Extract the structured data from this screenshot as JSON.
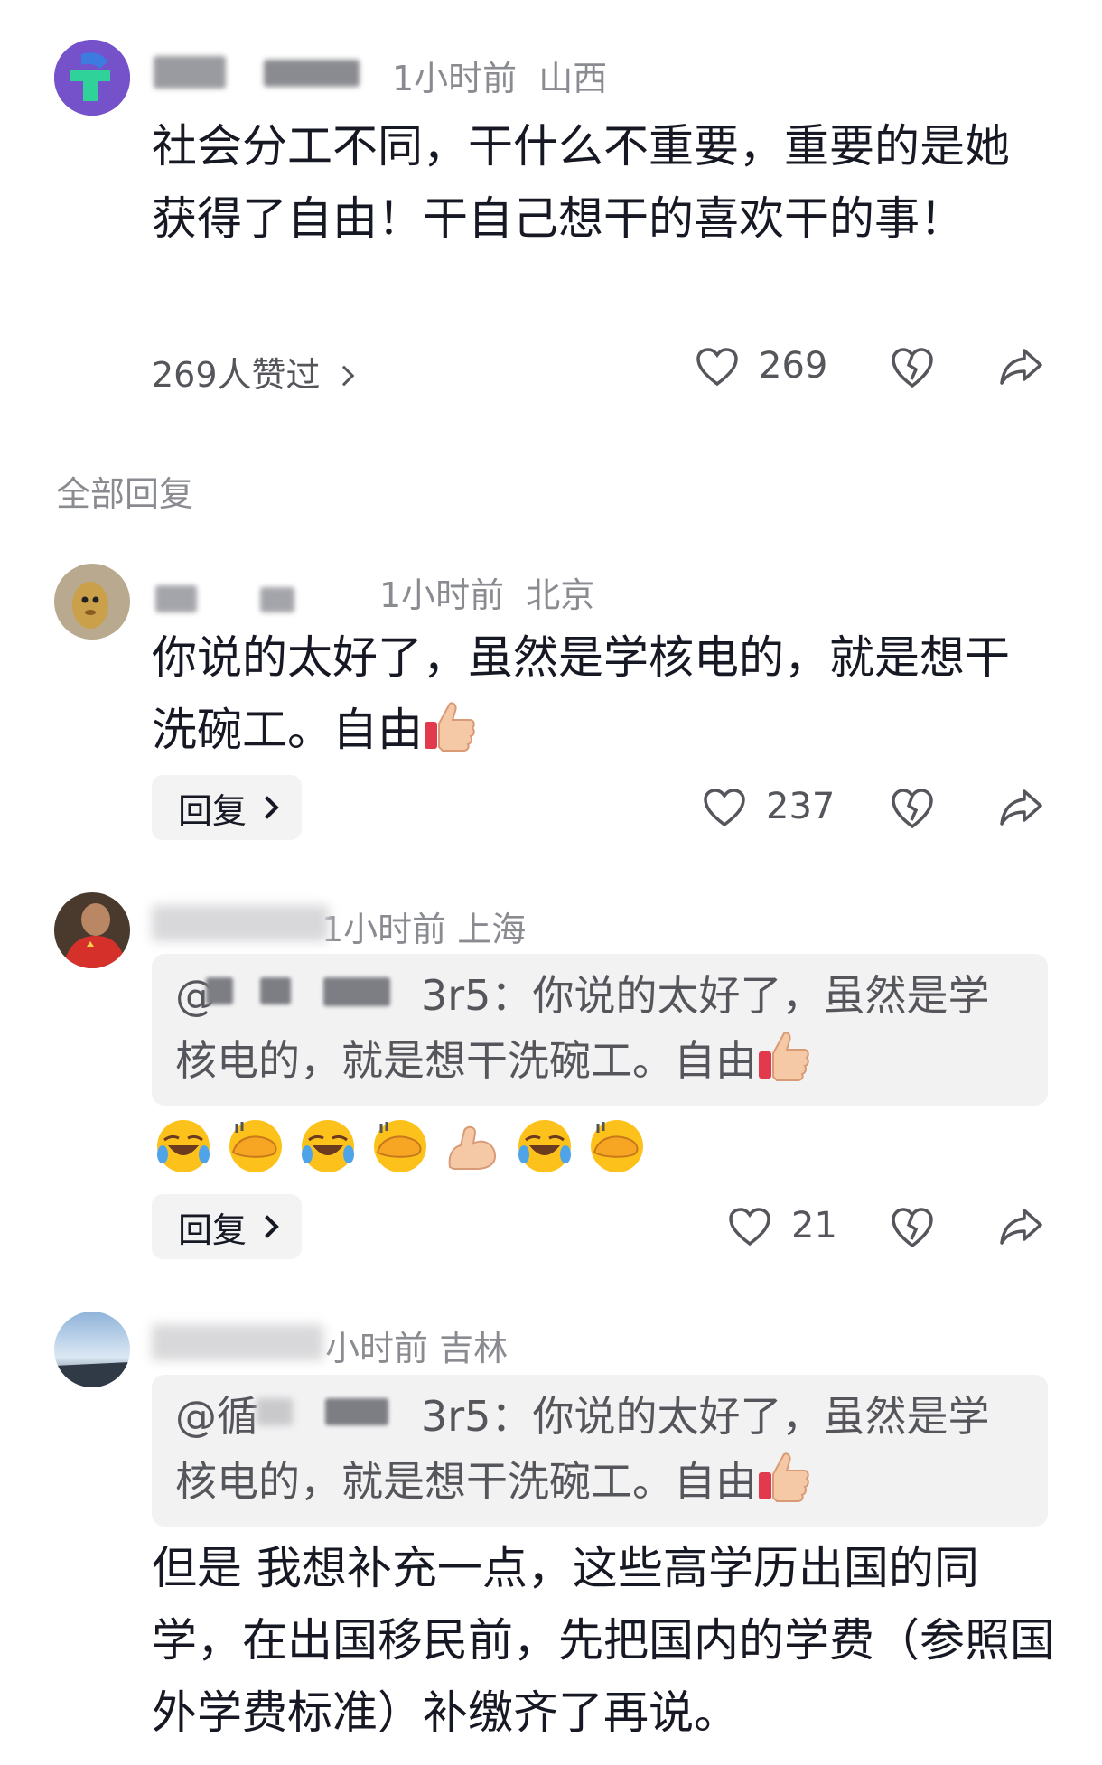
{
  "comment": {
    "time": "1小时前",
    "location": "山西",
    "text": "社会分工不同，干什么不重要，重要的是她获得了自由！干自己想干的喜欢干的事！",
    "likes_summary": "269人赞过",
    "like_count": "269"
  },
  "section_title": "全部回复",
  "replies": [
    {
      "time": "1小时前",
      "location": "北京",
      "text": "你说的太好了，虽然是学核电的，就是想干洗碗工。自由",
      "reply_label": "回复",
      "like_count": "237"
    },
    {
      "meta": "1小时前  上海",
      "quote": "3r5：你说的太好了，虽然是学核电的，就是想干洗碗工。自由",
      "quote_prefix": "@",
      "reply_label": "回复",
      "like_count": "21"
    },
    {
      "meta": "小时前  吉林",
      "quote_prefix": "@循",
      "quote": "3r5：你说的太好了，虽然是学核电的，就是想干洗碗工。自由",
      "text": "但是 我想补充一点，这些高学历出国的同学，在出国移民前，先把国内的学费（参照国外学费标准）补缴齐了再说。"
    }
  ],
  "icons": {
    "like": "heart-outline-icon",
    "dislike": "broken-heart-icon",
    "share": "share-arrow-icon",
    "thumb": "thumbs-up-emoji",
    "laugh_cry": "rolling-laugh-emoji",
    "facepalm": "face-with-hand-emoji",
    "muscle": "flexed-biceps-emoji"
  },
  "colors": {
    "text": "#161823",
    "secondary": "#8a8b91",
    "quote_bg": "#f2f2f3",
    "reply_bg": "#f3f3f4"
  }
}
